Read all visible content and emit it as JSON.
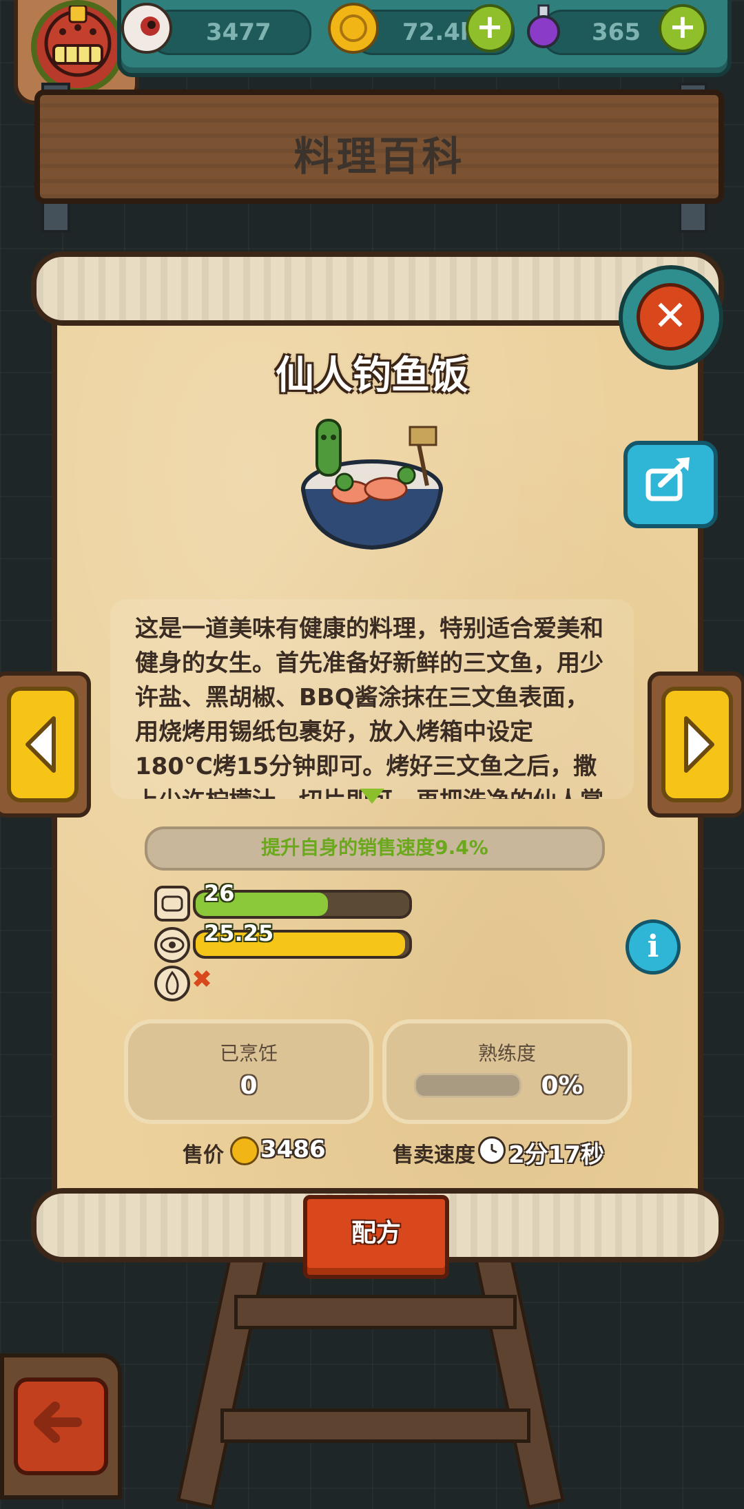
{
  "resources": {
    "eyeball": "3477",
    "coins": "72.4k",
    "potion": "365"
  },
  "page_title": "料理百科",
  "dish": {
    "name": "仙人钓鱼饭",
    "description": "这是一道美味有健康的料理，特别适合爱美和健身的女生。首先准备好新鲜的三文鱼，用少许盐、黑胡椒、BBQ酱涂抹在三文鱼表面，用烧烤用锡纸包裹好，放入烤箱中设定180°C烤15分钟即可。烤好三文鱼之后，撒上少许柠檬汁，切片即可。再把洗净的仙人掌",
    "bonus": "提升自身的销售速度9.4%",
    "stat_green": "26",
    "stat_green_fill": 0.62,
    "stat_yellow": "25.25",
    "stat_yellow_fill": 0.98,
    "fire_status": "✖",
    "cooked_label": "已烹饪",
    "cooked_value": "0",
    "proficiency_label": "熟练度",
    "proficiency_value": "0%",
    "proficiency_fill": 0.0,
    "price_label": "售价",
    "price_value": "3486",
    "speed_label": "售卖速度",
    "speed_value": "2分17秒"
  },
  "buttons": {
    "recipe": "配方",
    "close": "✕",
    "info": "i"
  },
  "colors": {
    "green_bar": "#8bc93a",
    "yellow_bar": "#f5c518",
    "bonus_text": "#6aa81c"
  }
}
